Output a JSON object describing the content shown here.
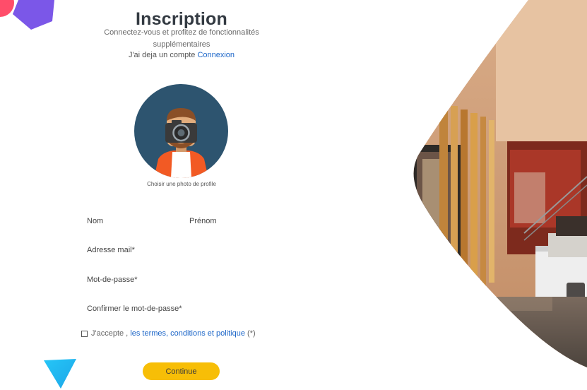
{
  "header": {
    "title": "Inscription",
    "subtitle": "Connectez-vous et profitez de fonctionnalités supplémentaires",
    "have_account_text": "J'ai deja un compte",
    "login_link": "Connexion"
  },
  "profile": {
    "caption": "Choisir une photo de profile"
  },
  "form": {
    "nom_label": "Nom",
    "prenom_label": "Prénom",
    "email_label": "Adresse mail*",
    "password_label": "Mot-de-passe*",
    "confirm_label": "Confirmer le mot-de-passe*",
    "nom_value": "",
    "prenom_value": "",
    "email_value": "",
    "password_value": "",
    "confirm_value": ""
  },
  "terms": {
    "prefix": "J'accepte ,",
    "link": "les termes, conditions et politique",
    "suffix": "(*)"
  },
  "actions": {
    "continue_label": "Continue"
  },
  "colors": {
    "accent": "#f7be07",
    "link": "#1c66c8",
    "avatar_bg": "#2d546f",
    "title": "#333a42"
  }
}
